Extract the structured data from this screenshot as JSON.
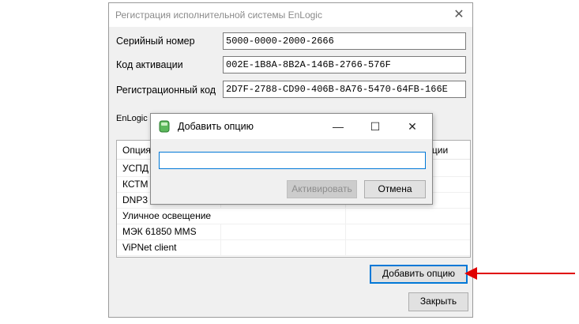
{
  "window": {
    "title": "Регистрация исполнительной системы EnLogic",
    "close_glyph": "✕"
  },
  "fields": {
    "serial_label": "Серийный номер",
    "serial_value": "5000-0000-2000-2666",
    "activation_label": "Код активации",
    "activation_value": "002E-1B8A-8B2A-146B-2766-576F",
    "reg_label": "Регистрационный код",
    "reg_value": "2D7F-2788-CD90-406B-8A76-5470-64FB-166E"
  },
  "section_label": "EnLogic S",
  "table": {
    "col1_header": "Опция",
    "col2_header": "вации",
    "rows": [
      "УСПД",
      "КСТМ",
      "DNP3",
      "Уличное освещение",
      "МЭК 61850 MMS",
      "ViPNet client"
    ]
  },
  "buttons": {
    "add_option": "Добавить опцию",
    "close": "Закрыть"
  },
  "dialog": {
    "title": "Добавить опцию",
    "minimize_glyph": "—",
    "maximize_glyph": "☐",
    "close_glyph": "✕",
    "input_value": "",
    "activate": "Активировать",
    "cancel": "Отмена"
  },
  "colors": {
    "accent": "#0078d7",
    "arrow": "#e00000",
    "icon_green": "#4caf50"
  }
}
